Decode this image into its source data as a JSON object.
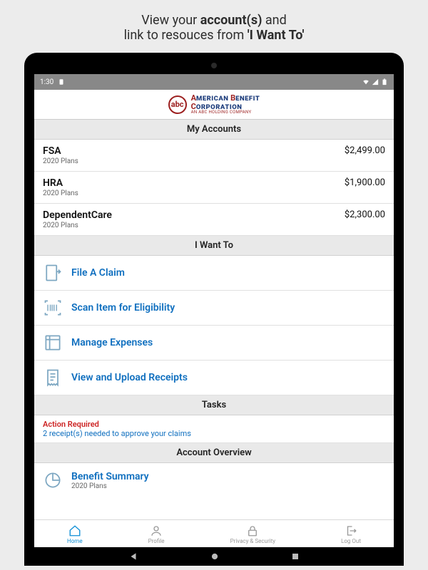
{
  "promo": {
    "line1_a": "View your ",
    "line1_b": "account(s)",
    "line1_c": " and",
    "line2_a": "link to resouces from ",
    "line2_b": "'I Want To'"
  },
  "status": {
    "time": "1:30"
  },
  "brand": {
    "name_line1": "American Benefit",
    "name_line2": "Corporation",
    "tagline": "AN ABC HOLDING COMPANY",
    "badge": "abc"
  },
  "sections": {
    "accounts_header": "My Accounts",
    "iwantto_header": "I Want To",
    "tasks_header": "Tasks",
    "overview_header": "Account Overview"
  },
  "accounts": [
    {
      "name": "FSA",
      "sub": "2020 Plans",
      "amount": "$2,499.00"
    },
    {
      "name": "HRA",
      "sub": "2020 Plans",
      "amount": "$1,900.00"
    },
    {
      "name": "DependentCare",
      "sub": "2020 Plans",
      "amount": "$2,300.00"
    }
  ],
  "actions": [
    {
      "label": "File A Claim",
      "icon": "file-claim-icon"
    },
    {
      "label": "Scan Item for Eligibility",
      "icon": "barcode-icon"
    },
    {
      "label": "Manage Expenses",
      "icon": "expenses-icon"
    },
    {
      "label": "View and Upload Receipts",
      "icon": "receipt-icon"
    }
  ],
  "tasks": {
    "action_required": "Action Required",
    "detail": "2 receipt(s) needed to approve your claims"
  },
  "overview": {
    "title": "Benefit Summary",
    "sub": "2020 Plans"
  },
  "nav": {
    "home": "Home",
    "profile": "Profile",
    "privacy": "Privacy & Security",
    "logout": "Log Out"
  }
}
